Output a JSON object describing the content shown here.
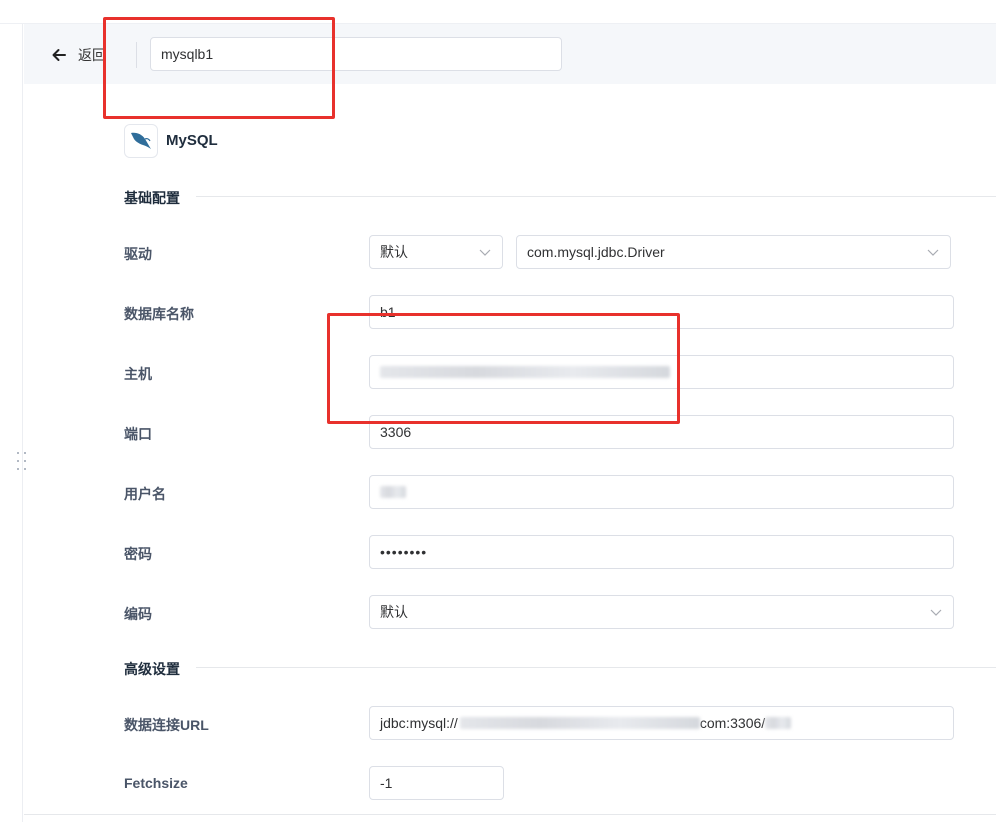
{
  "header": {
    "back_label": "返回",
    "name_value": "mysqlb1"
  },
  "datasource": {
    "type_label": "MySQL"
  },
  "basic": {
    "section_title": "基础配置",
    "driver_label": "驱动",
    "driver_mode": "默认",
    "driver_class": "com.mysql.jdbc.Driver",
    "dbname_label": "数据库名称",
    "dbname_value": "b1",
    "host_label": "主机",
    "port_label": "端口",
    "port_value": "3306",
    "user_label": "用户名",
    "password_label": "密码",
    "password_value": "••••••••",
    "encoding_label": "编码",
    "encoding_value": "默认"
  },
  "advanced": {
    "section_title": "高级设置",
    "url_label": "数据连接URL",
    "url_prefix": "jdbc:mysql://",
    "url_suffix": "com:3306/",
    "fetchsize_label": "Fetchsize",
    "fetchsize_value": "-1"
  },
  "colors": {
    "annotation": "#e8312c",
    "border": "#dcdfe6",
    "header_bg": "#f5f7fa"
  },
  "icons": {
    "back": "arrow-left-icon",
    "logo": "mysql-dolphin-icon",
    "dropdown": "chevron-down-icon",
    "drag": "drag-handle-icon"
  }
}
